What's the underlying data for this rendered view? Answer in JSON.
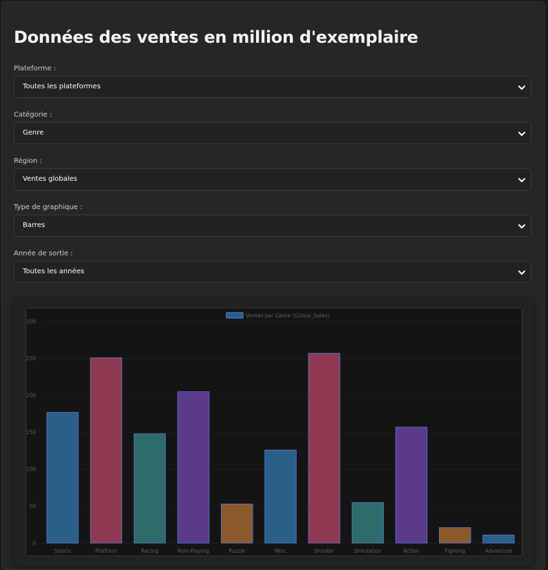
{
  "page": {
    "title": "Données des ventes en million d'exemplaire"
  },
  "filters": [
    {
      "label": "Plateforme :",
      "value": "Toutes les plateformes"
    },
    {
      "label": "Catégorie :",
      "value": "Genre"
    },
    {
      "label": "Région :",
      "value": "Ventes globales"
    },
    {
      "label": "Type de graphique :",
      "value": "Barres"
    },
    {
      "label": "Année de sortie :",
      "value": "Toutes les années"
    }
  ],
  "icons": {
    "dropdown": "chevron-down-icon"
  },
  "colors": {
    "background": "#1a1a1a",
    "panel": "#262626",
    "chart_background": "#141414",
    "blue": "#2a5f8a",
    "pink": "#8f3a52",
    "teal": "#2e6b6b",
    "purple": "#5b3a8c",
    "orange": "#8a5a2c",
    "bar_border": "#5b7fd6"
  },
  "chart_data": {
    "type": "bar",
    "legend": "Ventes par Genre (Global_Sales)",
    "legend_position": "top",
    "categories": [
      "Sports",
      "Platform",
      "Racing",
      "Role-Playing",
      "Puzzle",
      "Misc",
      "Shooter",
      "Simulation",
      "Action",
      "Fighting",
      "Adventure"
    ],
    "values": [
      177,
      251,
      148,
      205,
      53,
      126,
      257,
      55,
      157,
      21,
      11
    ],
    "bar_colors": [
      "#2a5f8a",
      "#8f3a52",
      "#2e6b6b",
      "#5b3a8c",
      "#8a5a2c",
      "#2a5f8a",
      "#8f3a52",
      "#2e6b6b",
      "#5b3a8c",
      "#8a5a2c",
      "#2a5f8a"
    ],
    "yticks": [
      "0",
      "50",
      "100",
      "150",
      "200",
      "250",
      "300"
    ],
    "ylim": [
      0,
      300
    ],
    "grid": true
  }
}
